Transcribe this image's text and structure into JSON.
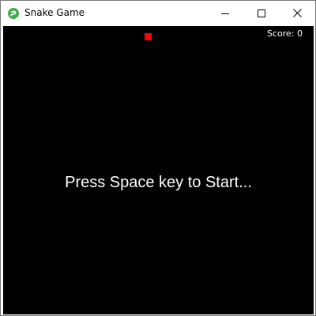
{
  "window": {
    "title": "Snake Game",
    "icon": "snake-app-icon",
    "controls": {
      "minimize_icon": "minimize-icon",
      "maximize_icon": "maximize-icon",
      "close_icon": "close-icon"
    }
  },
  "game": {
    "score_text": "Score: 0",
    "start_message": "Press Space key to Start...",
    "colors": {
      "background": "#000000",
      "food": "#ff0000",
      "text": "#ffffff"
    }
  }
}
